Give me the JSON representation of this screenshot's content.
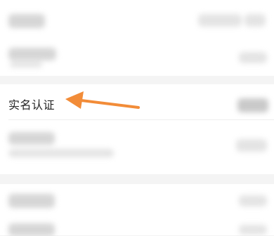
{
  "settings": {
    "realname_label": "实名认证",
    "arrow_color": "#F28C38",
    "background_color": "#F4F4F4",
    "row_background": "#FFFFFF"
  },
  "icons": {
    "annotation_arrow": "left-pointing-arrow-icon"
  }
}
